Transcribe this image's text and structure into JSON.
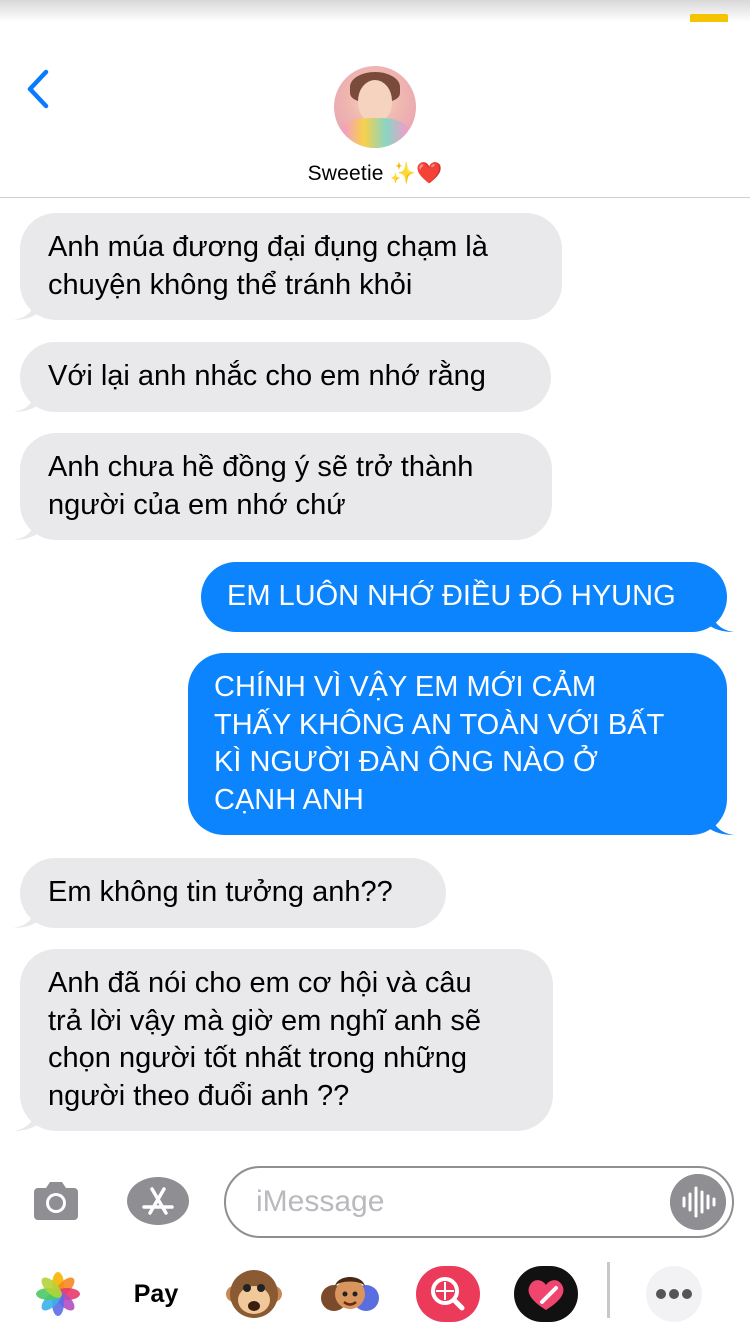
{
  "header": {
    "contact_name": "Sweetie ✨❤️"
  },
  "messages": [
    {
      "side": "received",
      "lines": [
        "Anh múa đương đại đụng chạm là",
        "chuyện không thể tránh khỏi"
      ]
    },
    {
      "side": "received",
      "lines": [
        "Với lại anh nhắc cho em nhớ rằng"
      ]
    },
    {
      "side": "received",
      "lines": [
        "Anh chưa hề đồng ý sẽ trở thành",
        "người của em nhớ chứ"
      ]
    },
    {
      "side": "sent",
      "lines": [
        "EM LUÔN NHỚ ĐIỀU ĐÓ HYUNG"
      ]
    },
    {
      "side": "sent",
      "lines": [
        "CHÍNH VÌ VẬY EM MỚI CẢM",
        "THẤY KHÔNG AN TOÀN VỚI BẤT",
        "KÌ NGƯỜI ĐÀN ÔNG NÀO Ở",
        "CẠNH ANH"
      ]
    },
    {
      "side": "received",
      "lines": [
        "Em không tin tưởng anh??"
      ]
    },
    {
      "side": "received",
      "lines": [
        "Anh đã nói cho em cơ hội và câu",
        "trả lời vậy mà giờ em nghĩ anh sẽ",
        "chọn người tốt nhất trong những",
        "người theo đuổi anh ??"
      ]
    }
  ],
  "input": {
    "placeholder": "iMessage",
    "value": ""
  },
  "app_drawer": {
    "items": [
      "photos-icon",
      "apple-pay",
      "monkey-animoji-icon",
      "memoji-icon",
      "search-images-icon",
      "digital-touch-icon",
      "more-icon"
    ],
    "apple_pay_label": " Pay"
  },
  "colors": {
    "sent_bubble": "#0b84fe",
    "received_bubble": "#e9e9eb",
    "accent": "#0a7aff",
    "battery": "#f5c400"
  }
}
